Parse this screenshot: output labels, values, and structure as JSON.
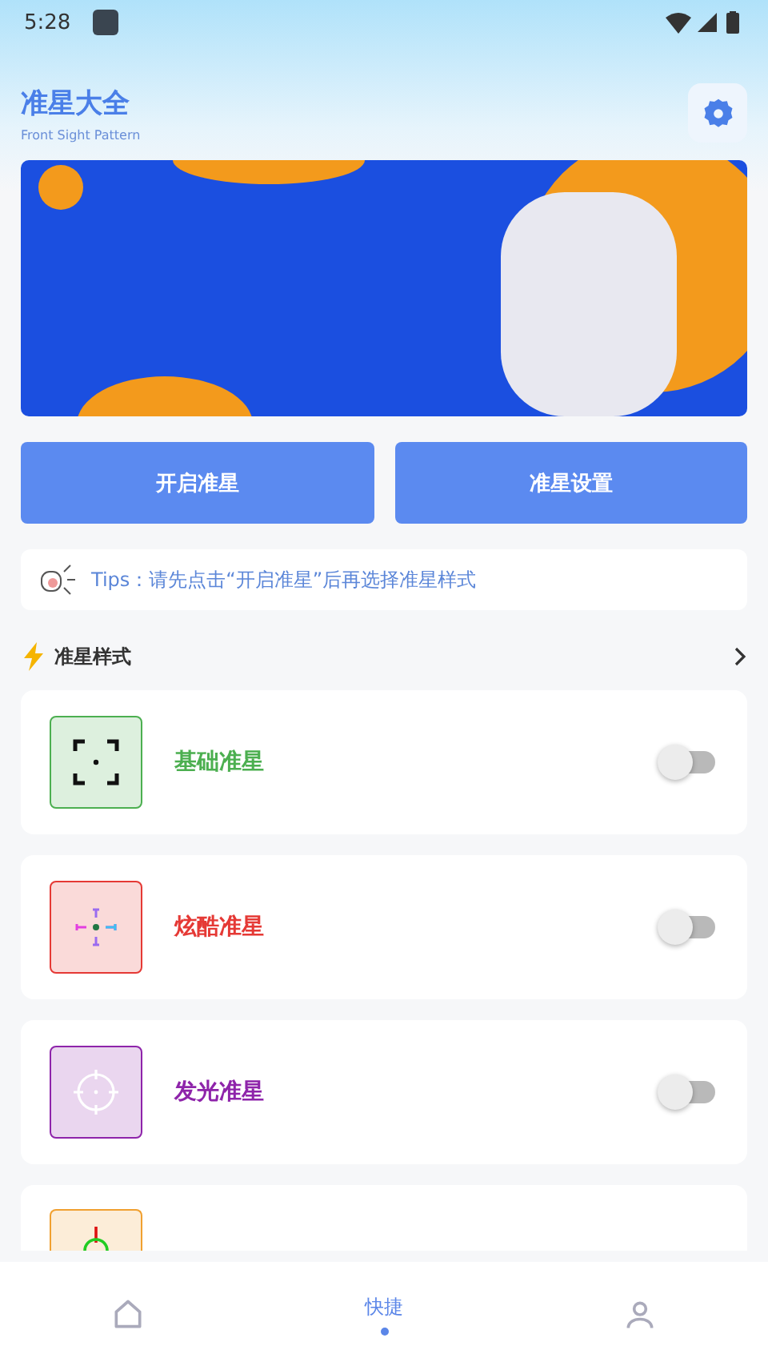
{
  "status_bar": {
    "time": "5:28"
  },
  "header": {
    "title": "准星大全",
    "subtitle": "Front Sight Pattern"
  },
  "buttons": [
    "开启准星",
    "准星设置"
  ],
  "tips": {
    "text": "Tips：请先点击“开启准星”后再选择准星样式"
  },
  "section": {
    "title": "准星样式"
  },
  "styles": [
    {
      "kind": "basic",
      "name": "基础准星",
      "color": "#4caf50",
      "on": false
    },
    {
      "kind": "cool",
      "name": "炫酷准星",
      "color": "#e53935",
      "on": false
    },
    {
      "kind": "glow",
      "name": "发光准星",
      "color": "#8e24aa",
      "on": false
    },
    {
      "kind": "circle",
      "color": "#f0a030",
      "partial": true
    }
  ],
  "nav": [
    {
      "kind": "home",
      "selected": false
    },
    {
      "kind": "shortcut",
      "label": "快捷",
      "selected": true
    },
    {
      "kind": "user",
      "selected": false
    }
  ]
}
